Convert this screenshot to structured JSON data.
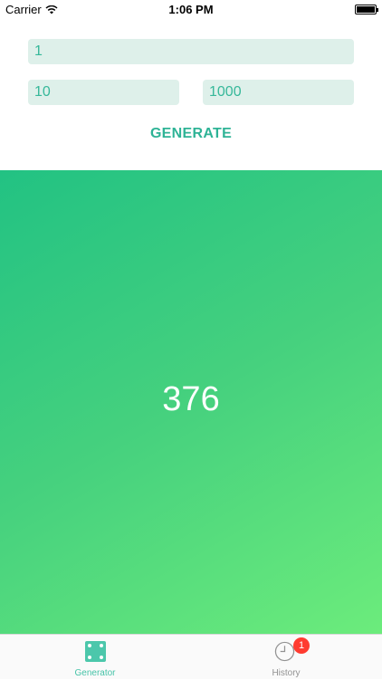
{
  "status_bar": {
    "carrier": "Carrier",
    "time": "1:06 PM",
    "battery_level": 1.0
  },
  "inputs": {
    "count_value": "1",
    "min_value": "10",
    "max_value": "1000"
  },
  "generate_label": "GENERATE",
  "result": {
    "value": "376"
  },
  "tabs": [
    {
      "label": "Generator",
      "icon": "dice-icon",
      "selected": true
    },
    {
      "label": "History",
      "icon": "clock-icon",
      "badge": "1",
      "selected": false
    }
  ],
  "colors": {
    "accent": "#36b89a",
    "input_background": "#def0ea",
    "gradient_start": "#22c283",
    "gradient_end": "#6cec7c",
    "badge": "#ff3b30"
  }
}
